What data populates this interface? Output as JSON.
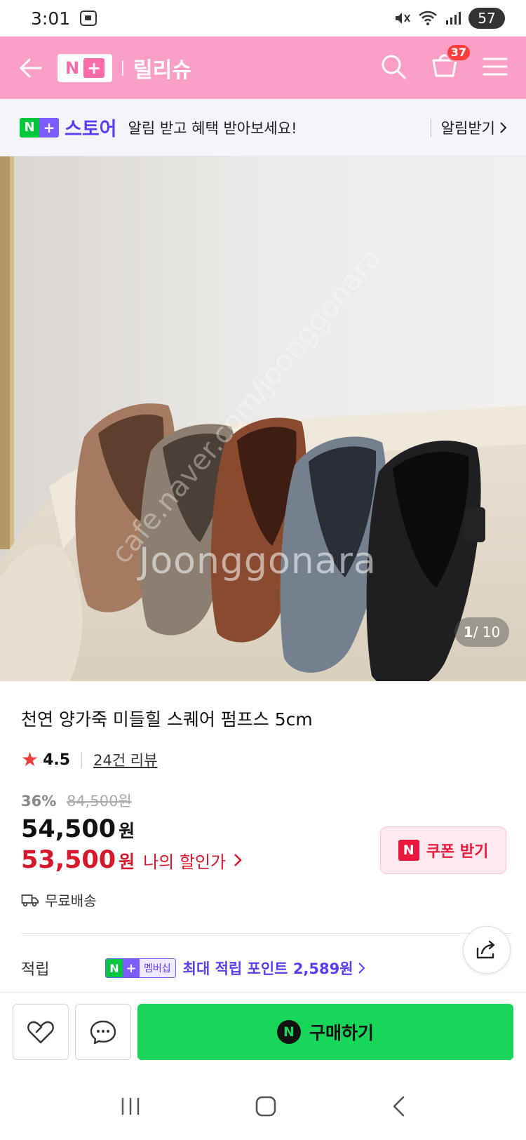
{
  "status_bar": {
    "time": "3:01",
    "battery": "57",
    "icons": [
      "screenshot-icon",
      "mute-icon",
      "wifi-icon",
      "signal-icon"
    ]
  },
  "header": {
    "logo_text_n": "N",
    "logo_text_plus": "+",
    "store_name": "릴리슈",
    "cart_count": "37",
    "brand_color": "#fc9fc6"
  },
  "notify": {
    "badge_n": "N",
    "badge_plus": "+",
    "store_label": "스토어",
    "message": "알림 받고 혜택 받아보세요!",
    "link_label": "알림받기"
  },
  "image": {
    "counter_current": "1",
    "counter_total": "/ 10",
    "watermark": "Joonggonara",
    "watermark_url": "cafe.naver.com/joonggonara"
  },
  "product": {
    "title": "천연 양가죽 미들힐 스퀘어 펌프스 5cm",
    "rating": "4.5",
    "review_link": "24건 리뷰",
    "discount_rate": "36%",
    "original_price": "84,500원",
    "sale_price": "54,500",
    "sale_won": "원",
    "my_price": "53,500",
    "my_won": "원",
    "my_price_label": "나의 할인가",
    "coupon_n": "N",
    "coupon_label": "쿠폰 받기",
    "shipping": "무료배송"
  },
  "points": {
    "label": "적립",
    "badge_n": "N",
    "badge_plus": "+",
    "badge_text": "멤버십",
    "text": "최대 적립 포인트 2,589원"
  },
  "action_bar": {
    "buy_n": "N",
    "buy_label": "구매하기",
    "buy_color": "#17d65a"
  }
}
